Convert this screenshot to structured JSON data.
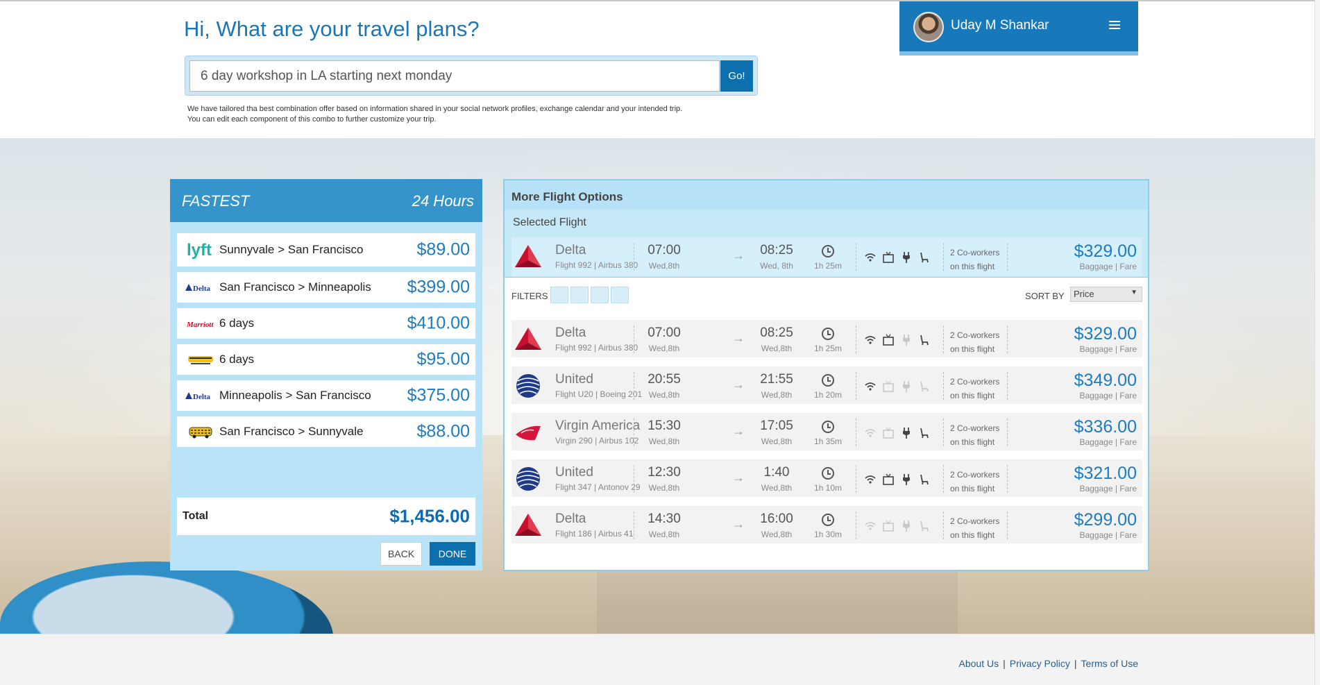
{
  "header": {
    "greeting": "Hi, What are your travel plans?",
    "search_value": "6 day workshop in LA starting next monday",
    "go_label": "Go!",
    "note_line1": "We have tailored tha best combination offer based on information shared in your social network profiles, exchange calendar and your intended trip.",
    "note_line2": "You can edit each component of this combo to further customize your trip."
  },
  "user": {
    "name": "Uday M Shankar"
  },
  "combo": {
    "title": "FASTEST",
    "duration": "24 Hours",
    "items": [
      {
        "logo": "lyft-logo",
        "desc": "Sunnyvale > San Francisco",
        "price": "$89.00"
      },
      {
        "logo": "delta-logo",
        "desc": "San Francisco > Minneapolis",
        "price": "$399.00"
      },
      {
        "logo": "marriott-logo",
        "desc": "6 days",
        "price": "$410.00"
      },
      {
        "logo": "car-rental-logo",
        "desc": "6 days",
        "price": "$95.00"
      },
      {
        "logo": "delta-logo",
        "desc": "Minneapolis > San Francisco",
        "price": "$375.00"
      },
      {
        "logo": "taxi-logo",
        "desc": "San Francisco > Sunnyvale",
        "price": "$88.00"
      }
    ],
    "total_label": "Total",
    "total_price": "$1,456.00",
    "back_label": "BACK",
    "done_label": "DONE"
  },
  "flights": {
    "panel_title": "More Flight Options",
    "selected_label": "Selected Flight",
    "filters_label": "FILTERS",
    "sort_label": "SORT BY",
    "sort_value": "Price",
    "baggage_fare": "Baggage | Fare",
    "coworkers_line1": "2 Co-workers",
    "coworkers_line2": "on this flight",
    "selected": {
      "airline": "Delta",
      "sub": "Flight 992 | Airbus 380",
      "dep": "07:00",
      "dep_date": "Wed,8th",
      "arr": "08:25",
      "arr_date": "Wed, 8th",
      "duration": "1h 25m",
      "price": "$329.00",
      "amenities": [
        true,
        true,
        true,
        true
      ],
      "logo": "delta-logo"
    },
    "list": [
      {
        "airline": "Delta",
        "sub": "Flight 992 | Airbus 380",
        "dep": "07:00",
        "dep_date": "Wed,8th",
        "arr": "08:25",
        "arr_date": "Wed,8th",
        "duration": "1h 25m",
        "price": "$329.00",
        "amenities": [
          true,
          true,
          false,
          true
        ],
        "logo": "delta-logo"
      },
      {
        "airline": "United",
        "sub": "Flight U20 | Boeing 201",
        "dep": "20:55",
        "dep_date": "Wed,8th",
        "arr": "21:55",
        "arr_date": "Wed,8th",
        "duration": "1h 20m",
        "price": "$349.00",
        "amenities": [
          true,
          false,
          false,
          false
        ],
        "logo": "united-logo"
      },
      {
        "airline": "Virgin America",
        "sub": "Virgin 290 | Airbus 102",
        "dep": "15:30",
        "dep_date": "Wed,8th",
        "arr": "17:05",
        "arr_date": "Wed,8th",
        "duration": "1h 35m",
        "price": "$336.00",
        "amenities": [
          false,
          false,
          true,
          true
        ],
        "logo": "virgin-logo"
      },
      {
        "airline": "United",
        "sub": "Flight 347 | Antonov 29",
        "dep": "12:30",
        "dep_date": "Wed,8th",
        "arr": "1:40",
        "arr_date": "Wed,8th",
        "duration": "1h 10m",
        "price": "$321.00",
        "amenities": [
          true,
          true,
          true,
          true
        ],
        "logo": "united-logo"
      },
      {
        "airline": "Delta",
        "sub": "Flight 186 | Airbus 41",
        "dep": "14:30",
        "dep_date": "Wed,8th",
        "arr": "16:00",
        "arr_date": "Wed,8th",
        "duration": "1h 30m",
        "price": "$299.00",
        "amenities": [
          false,
          false,
          false,
          false
        ],
        "logo": "delta-logo"
      }
    ]
  },
  "footer": {
    "about": "About Us",
    "privacy": "Privacy Policy",
    "terms": "Terms of Use",
    "sep": "|"
  },
  "colors": {
    "brand_blue": "#1779b9",
    "price_blue": "#1d7bc0",
    "panel_light": "#b6e1f6"
  }
}
